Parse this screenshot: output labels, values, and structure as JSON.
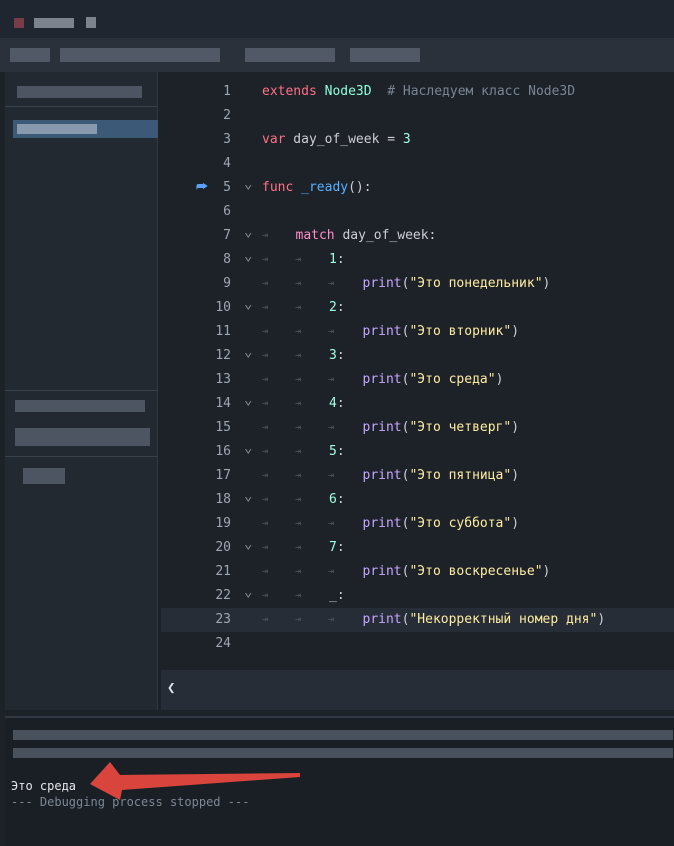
{
  "code": [
    {
      "n": "1",
      "segments": [
        {
          "t": "extends",
          "c": "kw"
        },
        {
          "t": " "
        },
        {
          "t": "Node3D",
          "c": "cls"
        },
        {
          "t": "  "
        },
        {
          "t": "# Наследуем класс Node3D",
          "c": "cm"
        }
      ]
    },
    {
      "n": "2",
      "segments": []
    },
    {
      "n": "3",
      "segments": [
        {
          "t": "var",
          "c": "kw"
        },
        {
          "t": " day_of_week = ",
          "c": "plain"
        },
        {
          "t": "3",
          "c": "num"
        }
      ]
    },
    {
      "n": "4",
      "segments": []
    },
    {
      "n": "5",
      "segments": [
        {
          "t": "func",
          "c": "kw"
        },
        {
          "t": " "
        },
        {
          "t": "_ready",
          "c": "fn"
        },
        {
          "t": "():",
          "c": "plain"
        }
      ]
    },
    {
      "n": "6",
      "segments": []
    },
    {
      "n": "7",
      "segments": [
        {
          "t": "match",
          "c": "kw2"
        },
        {
          "t": " day_of_week:",
          "c": "plain"
        }
      ]
    },
    {
      "n": "8",
      "segments": [
        {
          "t": "1",
          "c": "num"
        },
        {
          "t": ":",
          "c": "plain"
        }
      ]
    },
    {
      "n": "9",
      "segments": [
        {
          "t": "print",
          "c": "builtin"
        },
        {
          "t": "(",
          "c": "plain"
        },
        {
          "t": "\"Это понедельник\"",
          "c": "str"
        },
        {
          "t": ")",
          "c": "plain"
        }
      ]
    },
    {
      "n": "10",
      "segments": [
        {
          "t": "2",
          "c": "num"
        },
        {
          "t": ":",
          "c": "plain"
        }
      ]
    },
    {
      "n": "11",
      "segments": [
        {
          "t": "print",
          "c": "builtin"
        },
        {
          "t": "(",
          "c": "plain"
        },
        {
          "t": "\"Это вторник\"",
          "c": "str"
        },
        {
          "t": ")",
          "c": "plain"
        }
      ]
    },
    {
      "n": "12",
      "segments": [
        {
          "t": "3",
          "c": "num"
        },
        {
          "t": ":",
          "c": "plain"
        }
      ]
    },
    {
      "n": "13",
      "segments": [
        {
          "t": "print",
          "c": "builtin"
        },
        {
          "t": "(",
          "c": "plain"
        },
        {
          "t": "\"Это среда\"",
          "c": "str"
        },
        {
          "t": ")",
          "c": "plain"
        }
      ]
    },
    {
      "n": "14",
      "segments": [
        {
          "t": "4",
          "c": "num"
        },
        {
          "t": ":",
          "c": "plain"
        }
      ]
    },
    {
      "n": "15",
      "segments": [
        {
          "t": "print",
          "c": "builtin"
        },
        {
          "t": "(",
          "c": "plain"
        },
        {
          "t": "\"Это четверг\"",
          "c": "str"
        },
        {
          "t": ")",
          "c": "plain"
        }
      ]
    },
    {
      "n": "16",
      "segments": [
        {
          "t": "5",
          "c": "num"
        },
        {
          "t": ":",
          "c": "plain"
        }
      ]
    },
    {
      "n": "17",
      "segments": [
        {
          "t": "print",
          "c": "builtin"
        },
        {
          "t": "(",
          "c": "plain"
        },
        {
          "t": "\"Это пятница\"",
          "c": "str"
        },
        {
          "t": ")",
          "c": "plain"
        }
      ]
    },
    {
      "n": "18",
      "segments": [
        {
          "t": "6",
          "c": "num"
        },
        {
          "t": ":",
          "c": "plain"
        }
      ]
    },
    {
      "n": "19",
      "segments": [
        {
          "t": "print",
          "c": "builtin"
        },
        {
          "t": "(",
          "c": "plain"
        },
        {
          "t": "\"Это суббота\"",
          "c": "str"
        },
        {
          "t": ")",
          "c": "plain"
        }
      ]
    },
    {
      "n": "20",
      "segments": [
        {
          "t": "7",
          "c": "num"
        },
        {
          "t": ":",
          "c": "plain"
        }
      ]
    },
    {
      "n": "21",
      "segments": [
        {
          "t": "print",
          "c": "builtin"
        },
        {
          "t": "(",
          "c": "plain"
        },
        {
          "t": "\"Это воскресенье\"",
          "c": "str"
        },
        {
          "t": ")",
          "c": "plain"
        }
      ]
    },
    {
      "n": "22",
      "segments": [
        {
          "t": "_",
          "c": "plain"
        },
        {
          "t": ":",
          "c": "plain"
        }
      ]
    },
    {
      "n": "23",
      "segments": [
        {
          "t": "print",
          "c": "builtin"
        },
        {
          "t": "(",
          "c": "plain"
        },
        {
          "t": "\"Некорректный номер дня\"",
          "c": "str"
        },
        {
          "t": ")",
          "c": "plain"
        }
      ]
    },
    {
      "n": "24",
      "segments": []
    }
  ],
  "editor": {
    "collapse_glyph": "❮"
  },
  "output": {
    "result_line": "Это среда",
    "status_line": "--- Debugging process stopped ---"
  },
  "icons": {
    "breakpoint": "debug-arrow-icon",
    "fold": "chevron-down-icon",
    "tab": "tab-indent-icon"
  },
  "colors": {
    "accent": "#5aa2ff",
    "arrow": "#d9453c",
    "selection": "#3c5a78"
  }
}
